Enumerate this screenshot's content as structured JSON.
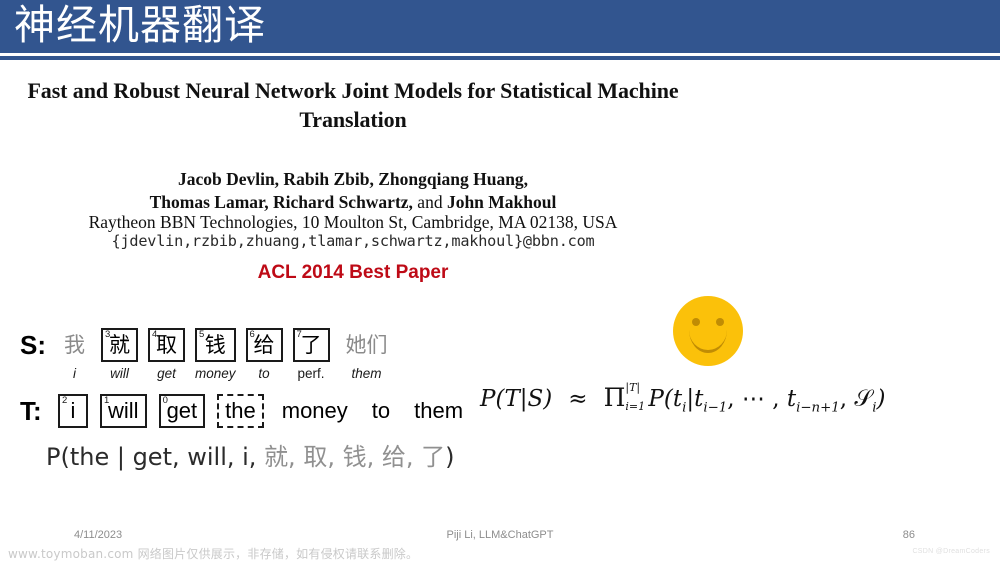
{
  "slide": {
    "title": "神经机器翻译",
    "banner_color": "#32558f"
  },
  "paper": {
    "title": "Fast and Robust Neural Network Joint Models for Statistical Machine Translation",
    "authors_line1": "Jacob Devlin, Rabih Zbib, Zhongqiang Huang,",
    "authors_line2_a": "Thomas Lamar, Richard Schwartz,",
    "authors_line2_conj": " and ",
    "authors_line2_b": "John Makhoul",
    "affiliation": "Raytheon BBN Technologies, 10 Moulton St, Cambridge, MA 02138, USA",
    "email": "{jdevlin,rzbib,zhuang,tlamar,schwartz,makhoul}@bbn.com",
    "award_badge": "ACL 2014 Best Paper",
    "award_color": "#be0a16"
  },
  "alignment": {
    "source_label": "S:",
    "target_label": "T:",
    "source_tokens": [
      {
        "text": "我",
        "gloss": "i",
        "index": "",
        "boxed": false,
        "dashed": false,
        "gloss_italic": true
      },
      {
        "text": "就",
        "gloss": "will",
        "index": "3",
        "boxed": true,
        "dashed": false,
        "gloss_italic": true
      },
      {
        "text": "取",
        "gloss": "get",
        "index": "4",
        "boxed": true,
        "dashed": false,
        "gloss_italic": true
      },
      {
        "text": "钱",
        "gloss": "money",
        "index": "5",
        "boxed": true,
        "dashed": false,
        "gloss_italic": true
      },
      {
        "text": "给",
        "gloss": "to",
        "index": "6",
        "boxed": true,
        "dashed": false,
        "gloss_italic": true
      },
      {
        "text": "了",
        "gloss": "perf.",
        "index": "7",
        "boxed": true,
        "dashed": false,
        "gloss_italic": false
      },
      {
        "text": "她们",
        "gloss": "them",
        "index": "",
        "boxed": false,
        "dashed": false,
        "gloss_italic": true
      }
    ],
    "target_tokens": [
      {
        "text": "i",
        "index": "2",
        "boxed": true,
        "dashed": false
      },
      {
        "text": "will",
        "index": "1",
        "boxed": true,
        "dashed": false
      },
      {
        "text": "get",
        "index": "0",
        "boxed": true,
        "dashed": false
      },
      {
        "text": "the",
        "index": "",
        "boxed": false,
        "dashed": true
      },
      {
        "text": "money",
        "index": "",
        "boxed": false,
        "dashed": false
      },
      {
        "text": "to",
        "index": "",
        "boxed": false,
        "dashed": false
      },
      {
        "text": "them",
        "index": "",
        "boxed": false,
        "dashed": false
      }
    ],
    "probability_expression_prefix": "P(the | get, will, i, ",
    "probability_expression_zh": "就, 取, 钱, 给, 了",
    "probability_expression_suffix": ")"
  },
  "formula": {
    "lhs": "P(T|S)",
    "relation": "≈",
    "pi_symbol": "Π",
    "pi_upper": "|T|",
    "pi_lower": "i=1",
    "rhs": "P(ti|ti−1, ⋯ , ti−n+1, 𝒮i)",
    "rhs_parts": {
      "p_open": "P(",
      "t_i": "t",
      "t_i_sub": "i",
      "bar": "|",
      "t_im1": "t",
      "t_im1_sub": "i−1",
      "dots": ", ⋯ , ",
      "t_inp1": "t",
      "t_inp1_sub": "i−n+1",
      "comma": ", ",
      "script_s": "𝒮",
      "script_s_sub": "i",
      "p_close": ")"
    }
  },
  "emoji": {
    "smiley_color": "#fbc10a",
    "smiley_feature_color": "#c08c04"
  },
  "footer": {
    "date": "4/11/2023",
    "center": "Piji Li, LLM&ChatGPT",
    "page_number": "86"
  },
  "watermark": {
    "notice": "www.toymoban.com 网络图片仅供展示，非存储，如有侵权请联系删除。",
    "credit": "CSDN @DreamCoders"
  }
}
